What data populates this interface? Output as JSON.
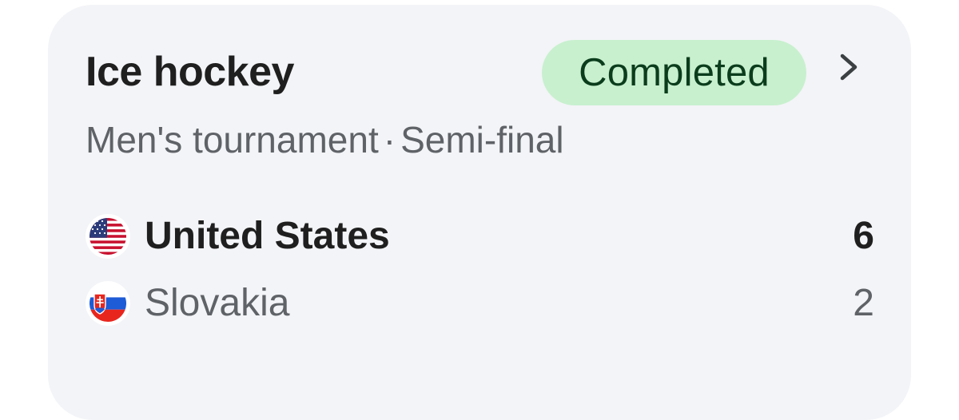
{
  "event": {
    "sport": "Ice hockey",
    "status": "Completed",
    "tournament": "Men's tournament",
    "separator": "·",
    "stage": "Semi-final"
  },
  "teams": [
    {
      "name": "United States",
      "score": "6",
      "flag": "us-flag-icon",
      "winner": true
    },
    {
      "name": "Slovakia",
      "score": "2",
      "flag": "slovakia-flag-icon",
      "winner": false
    }
  ],
  "colors": {
    "card_bg": "#f3f4f7",
    "badge_bg": "#c8f0cf",
    "badge_text": "#0b3d1c",
    "primary_text": "#1f1f1f",
    "secondary_text": "#5f6368"
  }
}
